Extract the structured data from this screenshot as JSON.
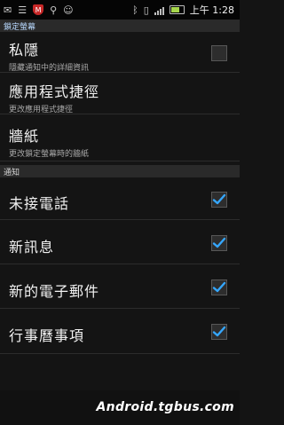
{
  "status_bar": {
    "left_icons": [
      "message-icon",
      "chat-icon",
      "mcafee-shield-icon",
      "usb-icon",
      "android-icon"
    ],
    "right_icons": [
      "bluetooth-icon",
      "vibrate-icon",
      "signal-icon",
      "battery-icon"
    ],
    "time": "上午 1:28"
  },
  "header": {
    "section_title": "鎖定螢幕"
  },
  "rows_top": [
    {
      "title": "私隱",
      "summary": "隱藏通知中的詳細資訊",
      "checked": false
    },
    {
      "title": "應用程式捷徑",
      "summary": "更改應用程式捷徑"
    },
    {
      "title": "牆紙",
      "summary": "更改鎖定螢幕時的牆紙"
    }
  ],
  "notify_section": {
    "title": "通知"
  },
  "notify_rows": [
    {
      "title": "未接電話",
      "checked": true
    },
    {
      "title": "新訊息",
      "checked": true
    },
    {
      "title": "新的電子郵件",
      "checked": true
    },
    {
      "title": "行事曆事項",
      "checked": true
    }
  ],
  "watermark": "Android.tgbus.com",
  "colors": {
    "accent_check": "#35a7ff",
    "section_bg": "#2a2a2a"
  }
}
